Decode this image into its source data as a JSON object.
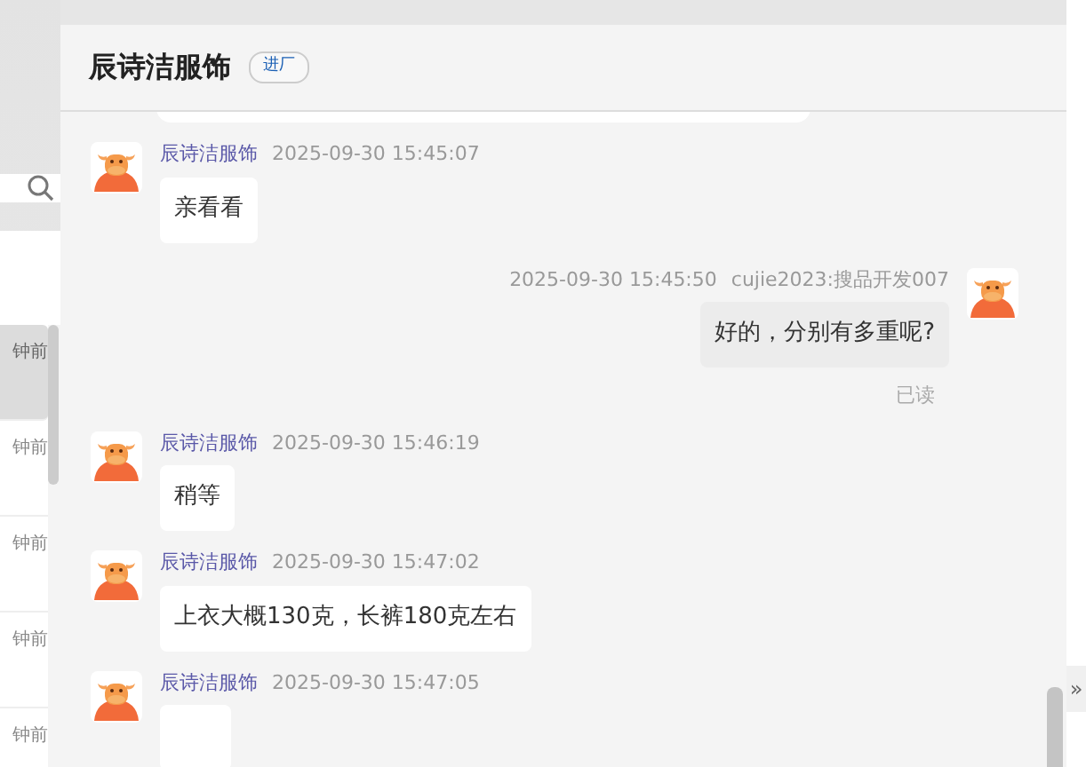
{
  "sidebar": {
    "items": [
      {
        "time": "钟前",
        "selected": true
      },
      {
        "time": "钟前",
        "selected": false
      },
      {
        "time": "钟前",
        "selected": false
      },
      {
        "time": "钟前",
        "selected": false
      },
      {
        "time": "钟前",
        "selected": false
      }
    ]
  },
  "chat": {
    "title": "辰诗洁服饰",
    "tag": "进厂",
    "messages": [
      {
        "kind": "clipped"
      },
      {
        "kind": "incoming",
        "sender": "辰诗洁服饰",
        "time": "2025-09-30 15:45:07",
        "text": "亲看看"
      },
      {
        "kind": "outgoing",
        "time": "2025-09-30 15:45:50",
        "sender": "cujie2023:搜品开发007",
        "text": "好的，分别有多重呢?",
        "status": "已读"
      },
      {
        "kind": "incoming",
        "sender": "辰诗洁服饰",
        "time": "2025-09-30 15:46:19",
        "text": "稍等"
      },
      {
        "kind": "incoming",
        "sender": "辰诗洁服饰",
        "time": "2025-09-30 15:47:02",
        "text": "上衣大概130克，长裤180克左右"
      },
      {
        "kind": "incoming",
        "sender": "辰诗洁服饰",
        "time": "2025-09-30 15:47:05"
      }
    ]
  },
  "side_toggle": {
    "text": "»"
  }
}
